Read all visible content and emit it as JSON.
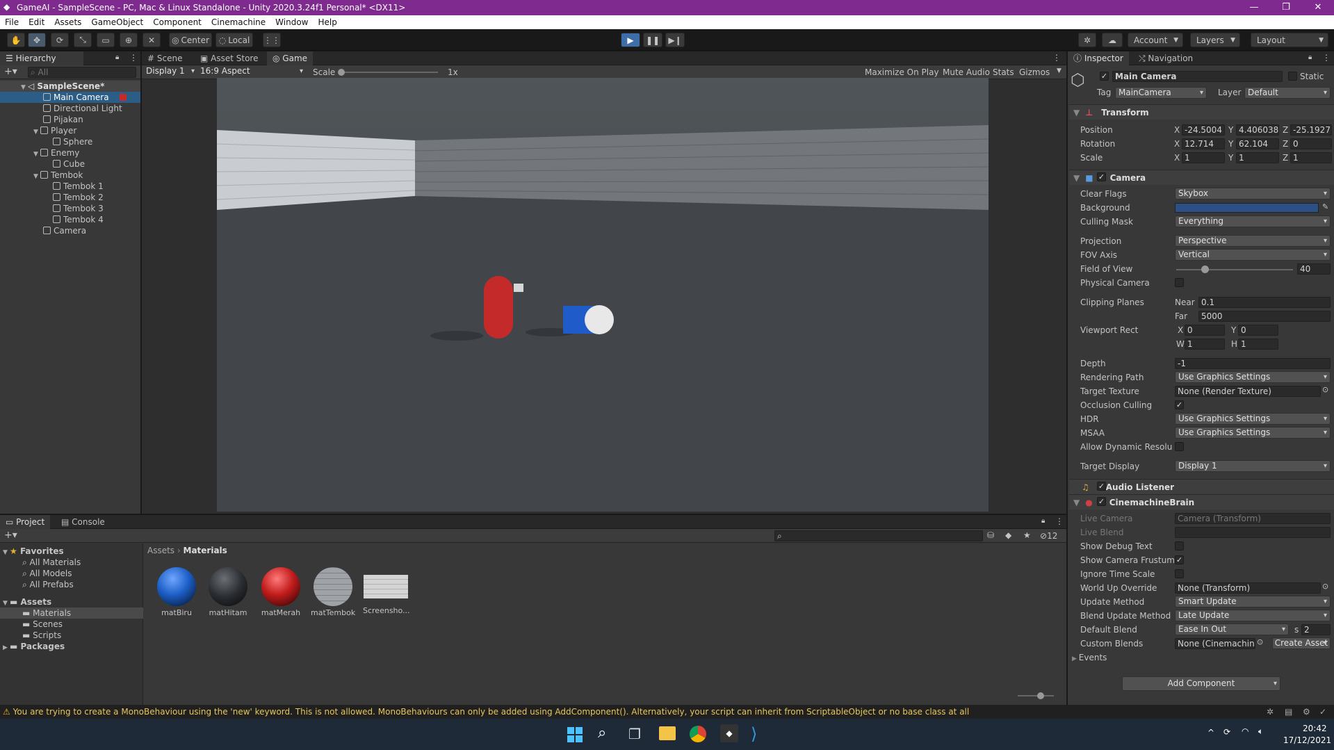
{
  "window": {
    "title": "GameAI - SampleScene - PC, Mac & Linux Standalone - Unity 2020.3.24f1 Personal* <DX11>",
    "min": "—",
    "max": "❐",
    "close": "✕"
  },
  "menu": [
    "File",
    "Edit",
    "Assets",
    "GameObject",
    "Component",
    "Cinemachine",
    "Window",
    "Help"
  ],
  "toolbar": {
    "center": "Center",
    "local": "Local",
    "account": "Account",
    "layers": "Layers",
    "layout": "Layout"
  },
  "hierarchy": {
    "tab": "Hierarchy",
    "search": "All",
    "scene": "SampleScene*",
    "items": [
      {
        "label": "Main Camera"
      },
      {
        "label": "Directional Light"
      },
      {
        "label": "Pijakan"
      },
      {
        "label": "Player"
      },
      {
        "label": "Sphere"
      },
      {
        "label": "Enemy"
      },
      {
        "label": "Cube"
      },
      {
        "label": "Tembok"
      },
      {
        "label": "Tembok 1"
      },
      {
        "label": "Tembok 2"
      },
      {
        "label": "Tembok 3"
      },
      {
        "label": "Tembok 4"
      },
      {
        "label": "Camera"
      }
    ]
  },
  "center_tabs": {
    "scene": "Scene",
    "asset_store": "Asset Store",
    "game": "Game"
  },
  "game_bar": {
    "display": "Display 1",
    "aspect": "16:9 Aspect",
    "scale": "Scale",
    "scale_value": "1x",
    "maximize": "Maximize On Play",
    "mute": "Mute Audio",
    "stats": "Stats",
    "gizmos": "Gizmos"
  },
  "inspector": {
    "tab": "Inspector",
    "nav_tab": "Navigation",
    "object_name": "Main Camera",
    "static": "Static",
    "tag_label": "Tag",
    "tag": "MainCamera",
    "layer_label": "Layer",
    "layer": "Default",
    "transform": {
      "title": "Transform",
      "position_label": "Position",
      "rotation_label": "Rotation",
      "scale_label": "Scale",
      "px": "-24.5004",
      "py": "4.406038",
      "pz": "-25.19271",
      "rx": "12.714",
      "ry": "62.104",
      "rz": "0",
      "sx": "1",
      "sy": "1",
      "sz": "1"
    },
    "camera": {
      "title": "Camera",
      "clear_flags_label": "Clear Flags",
      "clear_flags": "Skybox",
      "background_label": "Background",
      "background_color": "#2c4f86",
      "culling_mask_label": "Culling Mask",
      "culling_mask": "Everything",
      "projection_label": "Projection",
      "projection": "Perspective",
      "fov_axis_label": "FOV Axis",
      "fov_axis": "Vertical",
      "fov_label": "Field of View",
      "fov": "40",
      "physical_label": "Physical Camera",
      "clipping_label": "Clipping Planes",
      "near_label": "Near",
      "near": "0.1",
      "far_label": "Far",
      "far": "5000",
      "viewport_label": "Viewport Rect",
      "vx": "0",
      "vy": "0",
      "vw": "1",
      "vh": "1",
      "depth_label": "Depth",
      "depth": "-1",
      "rendering_path_label": "Rendering Path",
      "rendering_path": "Use Graphics Settings",
      "target_texture_label": "Target Texture",
      "target_texture": "None (Render Texture)",
      "occlusion_label": "Occlusion Culling",
      "hdr_label": "HDR",
      "hdr": "Use Graphics Settings",
      "msaa_label": "MSAA",
      "msaa": "Use Graphics Settings",
      "dyn_res_label": "Allow Dynamic Resoluti",
      "target_display_label": "Target Display",
      "target_display": "Display 1"
    },
    "audio_listener": {
      "title": "Audio Listener"
    },
    "brain": {
      "title": "CinemachineBrain",
      "live_camera_label": "Live Camera",
      "live_camera": "Camera (Transform)",
      "live_blend_label": "Live Blend",
      "debug_label": "Show Debug Text",
      "frustum_label": "Show Camera Frustum",
      "ignore_label": "Ignore Time Scale",
      "world_up_label": "World Up Override",
      "world_up": "None (Transform)",
      "update_label": "Update Method",
      "update": "Smart Update",
      "blend_update_label": "Blend Update Method",
      "blend_update": "Late Update",
      "default_blend_label": "Default Blend",
      "default_blend": "Ease In Out",
      "s_label": "s",
      "default_blend_time": "2",
      "custom_label": "Custom Blends",
      "custom": "None (Cinemachine I",
      "create_asset": "Create Asset",
      "events": "Events"
    },
    "add_component": "Add Component"
  },
  "project": {
    "tab": "Project",
    "console_tab": "Console",
    "favorites": "Favorites",
    "fav_items": [
      "All Materials",
      "All Models",
      "All Prefabs"
    ],
    "assets": "Assets",
    "asset_items": [
      "Materials",
      "Scenes",
      "Scripts"
    ],
    "packages": "Packages",
    "breadcrumb_root": "Assets",
    "breadcrumb_current": "Materials",
    "hidden_count": "12",
    "materials": [
      {
        "name": "matBiru",
        "color": "#1d5fc7"
      },
      {
        "name": "matHitam",
        "color": "#2a2d31"
      },
      {
        "name": "matMerah",
        "color": "#c21c1c"
      },
      {
        "name": "matTembok",
        "color": "#9fa3a8"
      },
      {
        "name": "Screensho..."
      }
    ]
  },
  "status": {
    "message": "You are trying to create a MonoBehaviour using the 'new' keyword.  This is not allowed.  MonoBehaviours can only be added using AddComponent(). Alternatively, your script can inherit from ScriptableObject or no base class at all"
  },
  "taskbar": {
    "time": "20:42",
    "date": "17/12/2021"
  }
}
